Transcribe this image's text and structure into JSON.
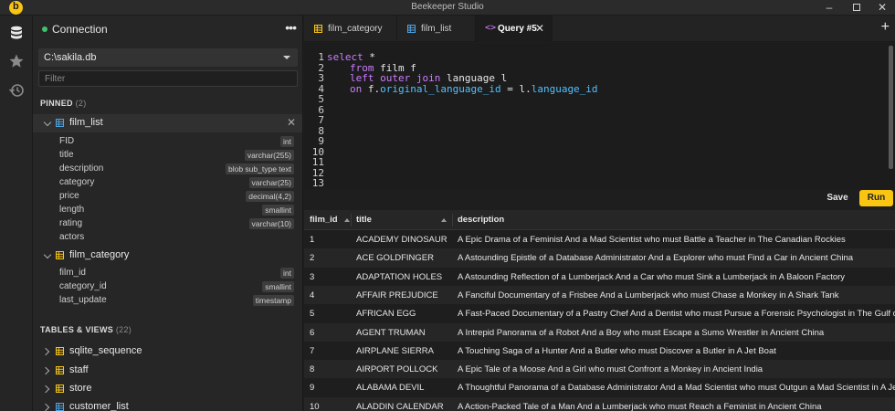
{
  "window": {
    "title": "Beekeeper Studio",
    "logo_letter": "b"
  },
  "sidebar": {
    "connection_label": "Connection",
    "more": "•••",
    "database": "C:\\sakila.db",
    "filter_placeholder": "Filter",
    "pinned_title": "PINNED",
    "pinned_count": "(2)",
    "pinned": [
      {
        "name": "film_list",
        "columns": [
          {
            "name": "FID",
            "type": "int"
          },
          {
            "name": "title",
            "type": "varchar(255)"
          },
          {
            "name": "description",
            "type": "blob sub_type text"
          },
          {
            "name": "category",
            "type": "varchar(25)"
          },
          {
            "name": "price",
            "type": "decimal(4,2)"
          },
          {
            "name": "length",
            "type": "smallint"
          },
          {
            "name": "rating",
            "type": "varchar(10)"
          },
          {
            "name": "actors",
            "type": ""
          }
        ]
      },
      {
        "name": "film_category",
        "columns": [
          {
            "name": "film_id",
            "type": "int"
          },
          {
            "name": "category_id",
            "type": "smallint"
          },
          {
            "name": "last_update",
            "type": "timestamp"
          }
        ]
      }
    ],
    "tables_title": "TABLES & VIEWS",
    "tables_count": "(22)",
    "tables": [
      {
        "name": "sqlite_sequence"
      },
      {
        "name": "staff"
      },
      {
        "name": "store"
      },
      {
        "name": "customer_list"
      }
    ]
  },
  "tabs": [
    {
      "label": "film_category"
    },
    {
      "label": "film_list"
    },
    {
      "label": "Query #5",
      "icon": "<>"
    }
  ],
  "new_tab": "+",
  "editor": {
    "line_numbers": [
      "1",
      "2",
      "3",
      "4",
      "5",
      "6",
      "7",
      "8",
      "9",
      "10",
      "11",
      "12",
      "13"
    ],
    "lines": {
      "l1_kw": "select",
      "l1_rest": " *",
      "l2_kw": "from",
      "l2_rest": " film f",
      "l3_kw1": "left outer join",
      "l3_rest": " language l",
      "l4_kw": "on",
      "l4_a": " f.",
      "l4_fn1": "original_language_id",
      "l4_b": " = l.",
      "l4_fn2": "language_id"
    }
  },
  "actions": {
    "save": "Save",
    "run": "Run"
  },
  "results": {
    "headers": [
      "film_id",
      "title",
      "description"
    ],
    "rows": [
      [
        "1",
        "ACADEMY DINOSAUR",
        "A Epic Drama of a Feminist And a Mad Scientist who must Battle a Teacher in The Canadian Rockies"
      ],
      [
        "2",
        "ACE GOLDFINGER",
        "A Astounding Epistle of a Database Administrator And a Explorer who must Find a Car in Ancient China"
      ],
      [
        "3",
        "ADAPTATION HOLES",
        "A Astounding Reflection of a Lumberjack And a Car who must Sink a Lumberjack in A Baloon Factory"
      ],
      [
        "4",
        "AFFAIR PREJUDICE",
        "A Fanciful Documentary of a Frisbee And a Lumberjack who must Chase a Monkey in A Shark Tank"
      ],
      [
        "5",
        "AFRICAN EGG",
        "A Fast-Paced Documentary of a Pastry Chef And a Dentist who must Pursue a Forensic Psychologist in The Gulf of Me"
      ],
      [
        "6",
        "AGENT TRUMAN",
        "A Intrepid Panorama of a Robot And a Boy who must Escape a Sumo Wrestler in Ancient China"
      ],
      [
        "7",
        "AIRPLANE SIERRA",
        "A Touching Saga of a Hunter And a Butler who must Discover a Butler in A Jet Boat"
      ],
      [
        "8",
        "AIRPORT POLLOCK",
        "A Epic Tale of a Moose And a Girl who must Confront a Monkey in Ancient India"
      ],
      [
        "9",
        "ALABAMA DEVIL",
        "A Thoughtful Panorama of a Database Administrator And a Mad Scientist who must Outgun a Mad Scientist in A Jet B"
      ],
      [
        "10",
        "ALADDIN CALENDAR",
        "A Action-Packed Tale of a Man And a Lumberjack who must Reach a Feminist in Ancient China"
      ]
    ]
  },
  "colors": {
    "accent": "#f9c513",
    "keyword": "#cc7bff",
    "identifier": "#4fc1ff",
    "connected": "#3ec36d"
  }
}
